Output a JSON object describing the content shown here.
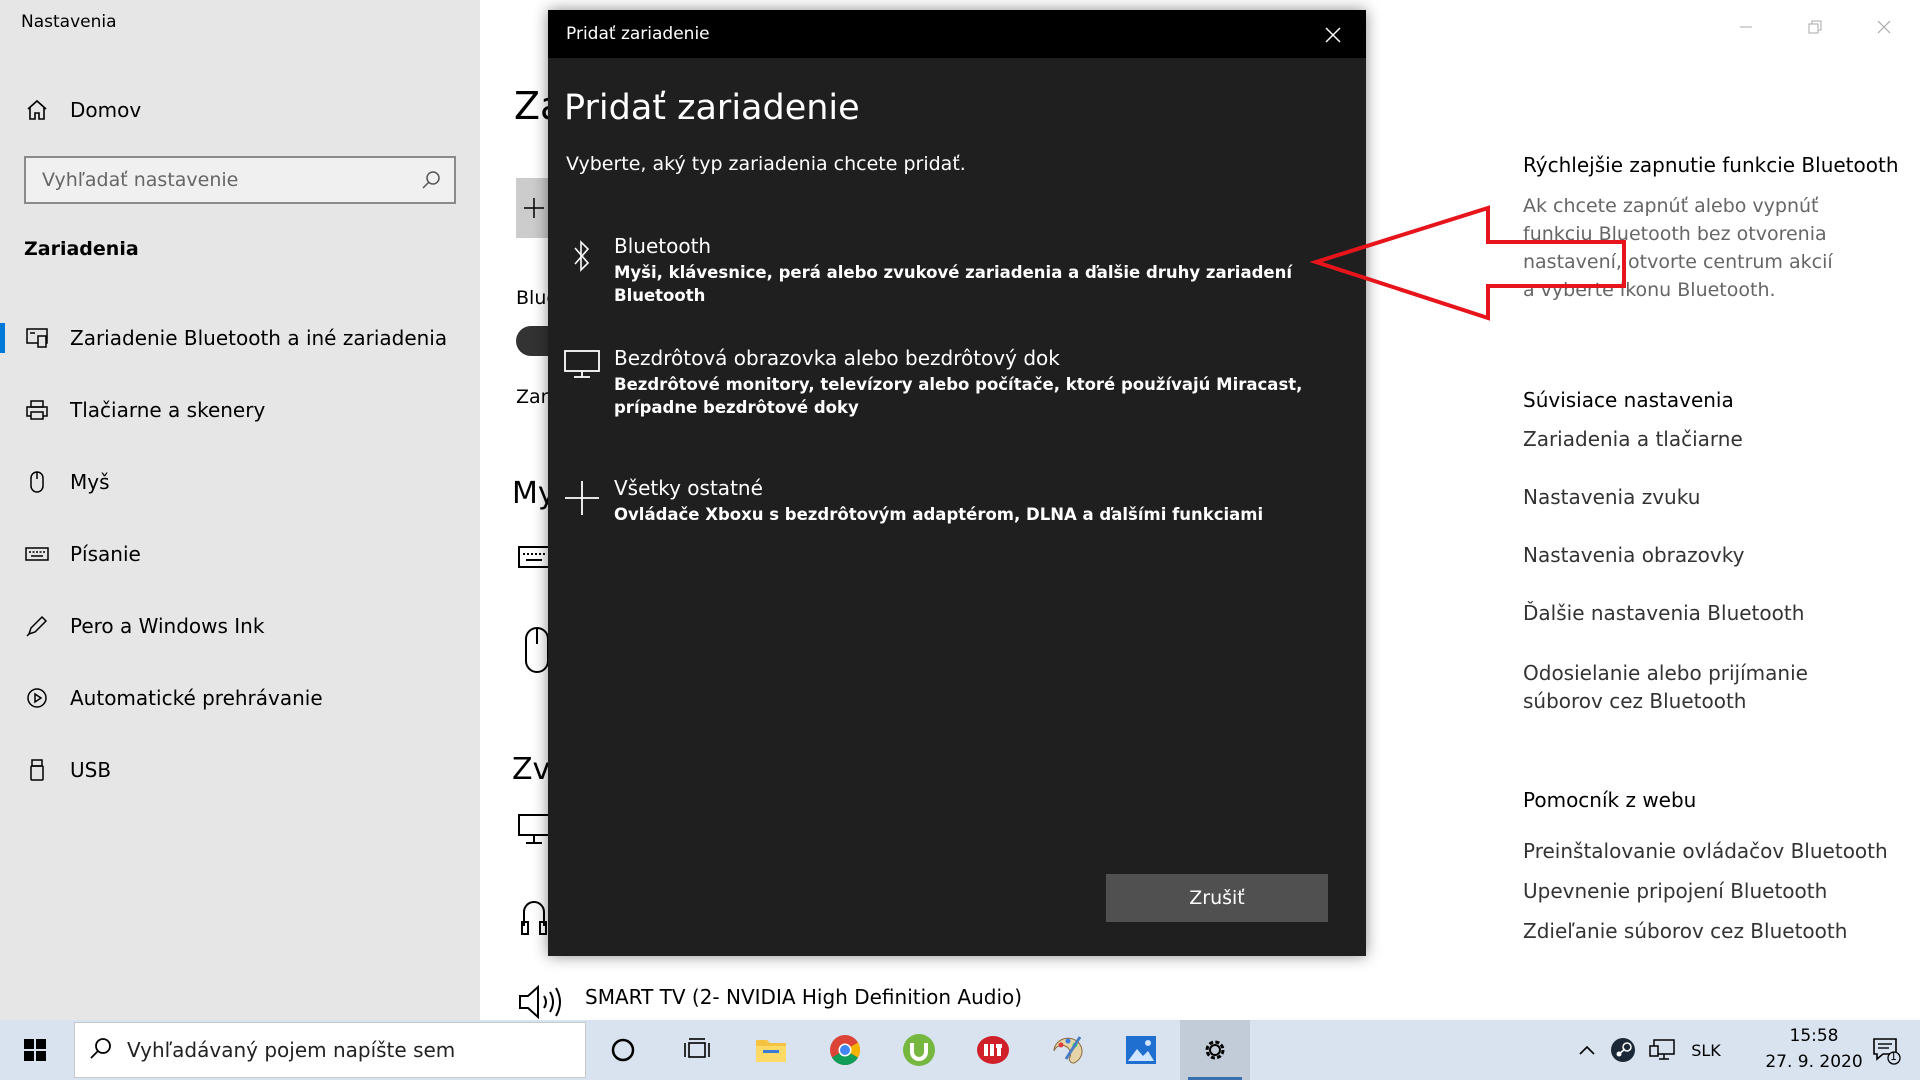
{
  "app": {
    "title": "Nastavenia"
  },
  "sidebar": {
    "home_label": "Domov",
    "search_placeholder": "Vyhľadať nastavenie",
    "section_title": "Zariadenia",
    "items": [
      {
        "label": "Zariadenie Bluetooth a iné zariadenia",
        "icon": "bluetooth-devices-icon",
        "active": true
      },
      {
        "label": "Tlačiarne a skenery",
        "icon": "printer-icon"
      },
      {
        "label": "Myš",
        "icon": "mouse-icon"
      },
      {
        "label": "Písanie",
        "icon": "keyboard-icon"
      },
      {
        "label": "Pero a Windows Ink",
        "icon": "pen-icon"
      },
      {
        "label": "Automatické prehrávanie",
        "icon": "autoplay-icon"
      },
      {
        "label": "USB",
        "icon": "usb-icon"
      }
    ]
  },
  "main_bg": {
    "heading_fragment": "Za",
    "bluetooth_fragment": "Blue",
    "zar_fragment": "Zar",
    "my_fragment": "My",
    "zv_fragment": "Zv",
    "smart_tv": "SMART TV (2- NVIDIA High Definition Audio)"
  },
  "right_panel": {
    "quick_title": "Rýchlejšie zapnutie funkcie Bluetooth",
    "quick_text": "Ak chcete zapnúť alebo vypnúť funkciu Bluetooth bez otvorenia nastavení, otvorte centrum akcií a vyberte ikonu Bluetooth.",
    "related_title": "Súvisiace nastavenia",
    "related_links": [
      "Zariadenia a tlačiarne",
      "Nastavenia zvuku",
      "Nastavenia obrazovky",
      "Ďalšie nastavenia Bluetooth",
      "Odosielanie alebo prijímanie súborov cez Bluetooth"
    ],
    "help_title": "Pomocník z webu",
    "help_links": [
      "Preinštalovanie ovládačov Bluetooth",
      "Upevnenie pripojení Bluetooth",
      "Zdieľanie súborov cez Bluetooth"
    ]
  },
  "dialog": {
    "titlebar": "Pridať zariadenie",
    "heading": "Pridať zariadenie",
    "subtitle": "Vyberte, aký typ zariadenia chcete pridať.",
    "options": [
      {
        "title": "Bluetooth",
        "desc": "Myši, klávesnice, perá alebo zvukové zariadenia a ďalšie druhy zariadení Bluetooth",
        "icon": "bluetooth-icon"
      },
      {
        "title": "Bezdrôtová obrazovka alebo bezdrôtový dok",
        "desc": "Bezdrôtové monitory, televízory alebo počítače, ktoré používajú Miracast, prípadne bezdrôtové doky",
        "icon": "monitor-icon"
      },
      {
        "title": "Všetky ostatné",
        "desc": "Ovládače Xboxu s bezdrôtovým adaptérom, DLNA a ďalšími funkciami",
        "icon": "plus-icon"
      }
    ],
    "cancel_label": "Zrušiť"
  },
  "annotation": {
    "arrow_color": "#e8141b"
  },
  "taskbar": {
    "search_placeholder": "Vyhľadávaný pojem napíšte sem",
    "language": "SLK",
    "time": "15:58",
    "date": "27. 9. 2020",
    "notification_count": "1"
  },
  "colors": {
    "accent": "#0078d7",
    "dialog_bg": "#1f1f1f",
    "taskbar_bg": "#d9e2ef"
  }
}
